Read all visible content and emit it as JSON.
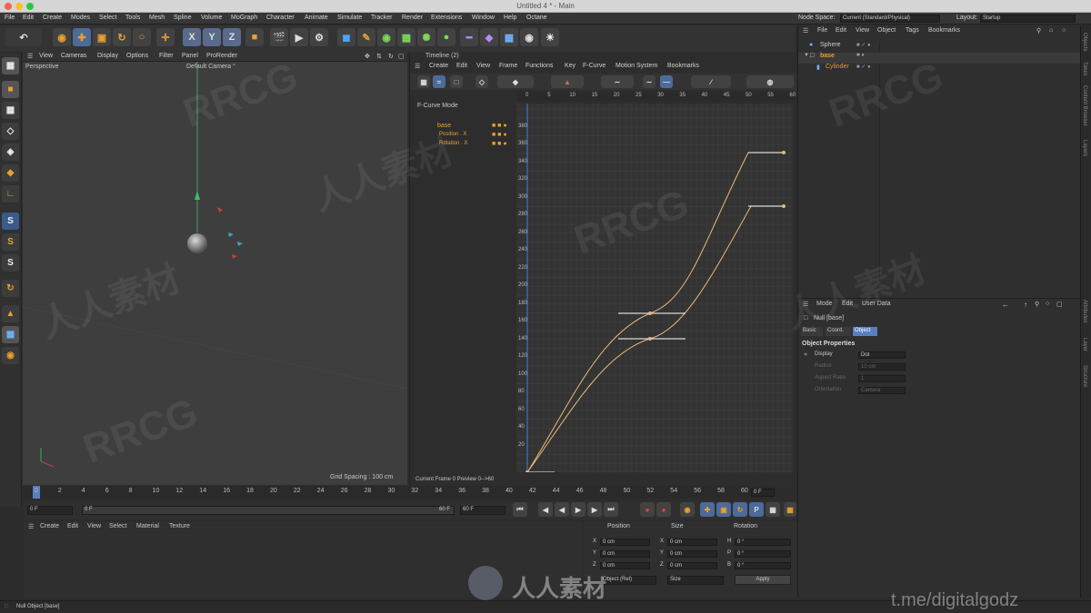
{
  "window": {
    "title": "Untitled 4 * - Main"
  },
  "menu": [
    "File",
    "Edit",
    "Create",
    "Modes",
    "Select",
    "Tools",
    "Mesh",
    "Spline",
    "Volume",
    "MoGraph",
    "Character",
    "Animate",
    "Simulate",
    "Tracker",
    "Render",
    "Extensions",
    "Window",
    "Help",
    "Octane"
  ],
  "node_space": {
    "label": "Node Space:",
    "value": "Current (Standard/Physical)"
  },
  "layout": {
    "label": "Layout:",
    "value": "Startup"
  },
  "toolbar": {
    "x": "X",
    "y": "Y",
    "z": "Z"
  },
  "left_tools": [
    "S",
    "S",
    "S"
  ],
  "viewport": {
    "menu": [
      "View",
      "Cameras",
      "Display",
      "Options",
      "Filter",
      "Panel",
      "ProRender"
    ],
    "name": "Perspective",
    "camera": "Default Camera °",
    "grid_spacing": "Grid Spacing : 100 cm"
  },
  "timeline": {
    "title": "Timeline (2)",
    "menu": [
      "Create",
      "Edit",
      "View",
      "Frame",
      "Functions",
      "Key",
      "F-Curve",
      "Motion System",
      "Bookmarks"
    ],
    "mode": "F-Curve Mode",
    "tracks": [
      "base",
      "Position . X",
      "Rotation . X"
    ],
    "frame_ticks": [
      "0",
      "5",
      "10",
      "15",
      "20",
      "25",
      "30",
      "35",
      "40",
      "45",
      "50",
      "55",
      "60"
    ],
    "value_ticks": [
      "20",
      "40",
      "60",
      "80",
      "100",
      "120",
      "140",
      "160",
      "180",
      "200",
      "220",
      "240",
      "260",
      "280",
      "300",
      "320",
      "340",
      "360",
      "380"
    ],
    "current": "Current Frame  0   Preview  0-->60"
  },
  "ruler_ticks": [
    "0",
    "2",
    "4",
    "6",
    "8",
    "10",
    "12",
    "14",
    "16",
    "18",
    "20",
    "22",
    "24",
    "26",
    "28",
    "30",
    "32",
    "34",
    "36",
    "38",
    "40",
    "42",
    "44",
    "46",
    "48",
    "50",
    "52",
    "54",
    "56",
    "58",
    "60"
  ],
  "playback": {
    "start": "0 F",
    "start2": "0 F",
    "end": "60 F",
    "end2": "60 F",
    "frame": "0 F"
  },
  "object_manager": {
    "menu": [
      "File",
      "Edit",
      "View",
      "Object",
      "Tags",
      "Bookmarks"
    ],
    "objects": [
      "Sphere",
      "base",
      "Cylinder"
    ]
  },
  "attributes": {
    "menu": [
      "Mode",
      "Edit",
      "User Data"
    ],
    "object": "Null [base]",
    "tabs": [
      "Basic",
      "Coord.",
      "Object"
    ],
    "section": "Object Properties",
    "rows": [
      {
        "label": "Display",
        "value": "Dot"
      },
      {
        "label": "Radius",
        "value": "10 cm"
      },
      {
        "label": "Aspect Ratio",
        "value": "1"
      },
      {
        "label": "Orientation",
        "value": "Camera"
      }
    ]
  },
  "material": {
    "menu": [
      "Create",
      "Edit",
      "View",
      "Select",
      "Material",
      "Texture"
    ]
  },
  "coords": {
    "headers": [
      "Position",
      "Size",
      "Rotation"
    ],
    "rows": [
      {
        "a": "X",
        "av": "0 cm",
        "b": "X",
        "bv": "0 cm",
        "c": "H",
        "cv": "0 °"
      },
      {
        "a": "Y",
        "av": "0 cm",
        "b": "Y",
        "bv": "0 cm",
        "c": "P",
        "cv": "0 °"
      },
      {
        "a": "Z",
        "av": "0 cm",
        "b": "Z",
        "bv": "0 cm",
        "c": "B",
        "cv": "0 °"
      }
    ],
    "mode": "Object (Rel)",
    "size_mode": "Size",
    "apply": "Apply"
  },
  "status": "Null Object [base]",
  "watermarks": [
    "RRCG",
    "人人素材",
    "t.me/digitalgodz"
  ],
  "right_strip": [
    "Objects",
    "Takes",
    "Content Browser",
    "Layers",
    "Attributes",
    "Layer",
    "Structure"
  ]
}
